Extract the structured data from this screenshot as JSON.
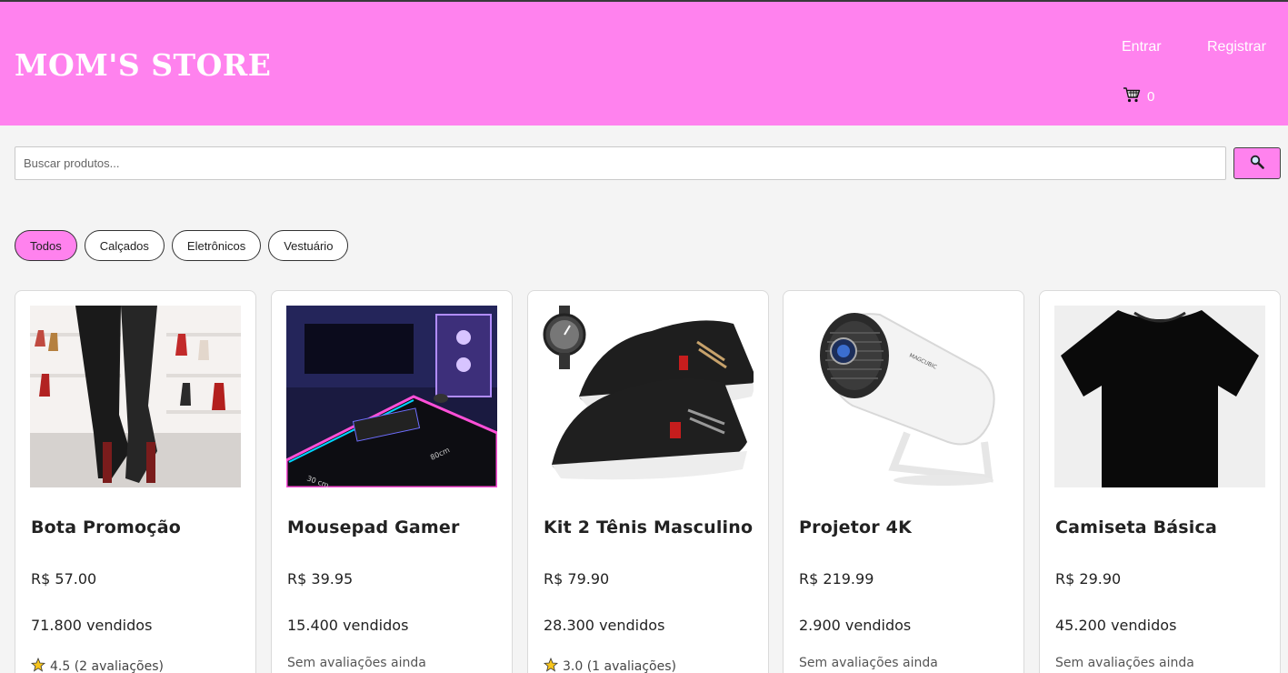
{
  "header": {
    "brand": "MOM'S STORE",
    "login_label": "Entrar",
    "register_label": "Registrar",
    "cart_count": "0"
  },
  "search": {
    "placeholder": "Buscar produtos...",
    "value": ""
  },
  "categories": [
    {
      "label": "Todos",
      "active": true
    },
    {
      "label": "Calçados",
      "active": false
    },
    {
      "label": "Eletrônicos",
      "active": false
    },
    {
      "label": "Vestuário",
      "active": false
    }
  ],
  "products": [
    {
      "name": "Bota Promoção",
      "price": "R$ 57.00",
      "sold": "71.800 vendidos",
      "rating_text": "4.5 (2 avaliações)",
      "image": "thigh-high-boots-photo"
    },
    {
      "name": "Mousepad Gamer",
      "price": "R$ 39.95",
      "sold": "15.400 vendidos",
      "rating_text": "Sem avaliações ainda",
      "image": "rgb-mousepad-photo"
    },
    {
      "name": "Kit 2 Tênis Masculino",
      "price": "R$ 79.90",
      "sold": "28.300 vendidos",
      "rating_text": "3.0 (1 avaliações)",
      "image": "sneakers-and-watch-photo"
    },
    {
      "name": "Projetor 4K",
      "price": "R$ 219.99",
      "sold": "2.900 vendidos",
      "rating_text": "Sem avaliações ainda",
      "image": "projector-photo"
    },
    {
      "name": "Camiseta Básica",
      "price": "R$ 29.90",
      "sold": "45.200 vendidos",
      "rating_text": "Sem avaliações ainda",
      "image": "black-tshirt-photo"
    }
  ],
  "icons": {
    "search": "magnifier-icon",
    "cart": "cart-icon",
    "rating": "star-icon"
  },
  "colors": {
    "accent": "#ff82ee",
    "background": "#f4f4f4"
  }
}
